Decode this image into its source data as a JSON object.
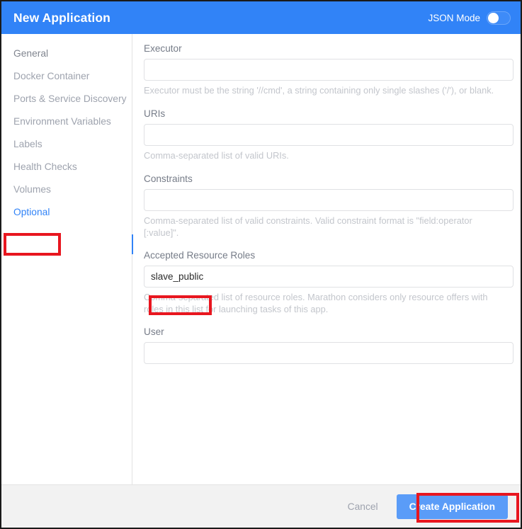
{
  "header": {
    "title": "New Application",
    "json_mode_label": "JSON Mode",
    "toggle_state": "off",
    "accent_color": "#3183f7"
  },
  "sidebar": {
    "items": [
      {
        "label": "General",
        "active": false
      },
      {
        "label": "Docker Container",
        "active": false
      },
      {
        "label": "Ports & Service Discovery",
        "active": false
      },
      {
        "label": "Environment Variables",
        "active": false
      },
      {
        "label": "Labels",
        "active": false
      },
      {
        "label": "Health Checks",
        "active": false
      },
      {
        "label": "Volumes",
        "active": false
      },
      {
        "label": "Optional",
        "active": true
      }
    ]
  },
  "form": {
    "fields": [
      {
        "label": "Executor",
        "value": "",
        "help": "Executor must be the string '//cmd', a string containing only single slashes ('/'), or blank."
      },
      {
        "label": "URIs",
        "value": "",
        "help": "Comma-separated list of valid URIs."
      },
      {
        "label": "Constraints",
        "value": "",
        "help": "Comma-separated list of valid constraints. Valid constraint format is \"field:operator [:value]\"."
      },
      {
        "label": "Accepted Resource Roles",
        "value": "slave_public",
        "help": "Comma-separated list of resource roles. Marathon considers only resource offers with roles in this list for launching tasks of this app."
      },
      {
        "label": "User",
        "value": "",
        "help": ""
      }
    ]
  },
  "footer": {
    "cancel_label": "Cancel",
    "create_label": "Create Application"
  },
  "annotations": {
    "color": "#e8161f",
    "targets": [
      "Optional",
      "slave_public",
      "Create Application"
    ]
  }
}
